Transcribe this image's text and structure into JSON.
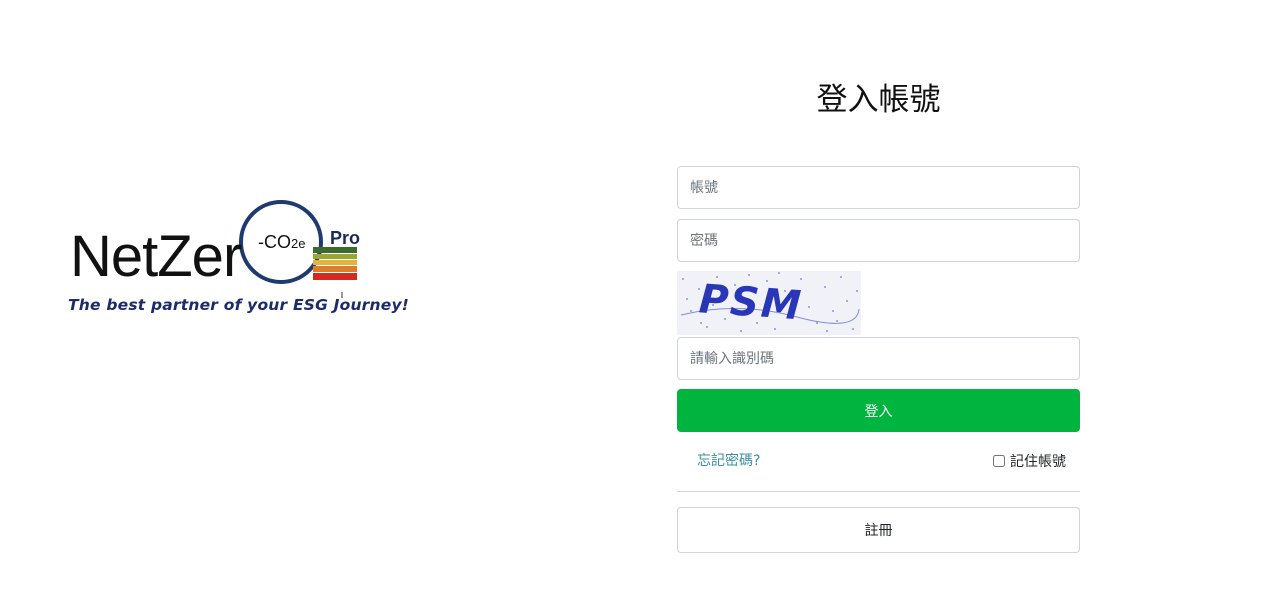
{
  "logo": {
    "wordmark": "NetZer",
    "co2_prefix": "-CO",
    "co2_sub": "2e",
    "badge": "Pro",
    "tagline": "The best partner of your ESG Journey!",
    "colors": {
      "ring": "#1e3a6e",
      "bars": [
        "#3c6a2a",
        "#9aa636",
        "#e0b53a",
        "#e07b2b",
        "#d22a1e"
      ]
    }
  },
  "login": {
    "title": "登入帳號",
    "account_placeholder": "帳號",
    "password_placeholder": "密碼",
    "captcha_text": "PSM",
    "captcha_placeholder": "請輸入識別碼",
    "login_label": "登入",
    "forgot_label": "忘記密碼?",
    "remember_label": "記住帳號",
    "remember_checked": false,
    "register_label": "註冊"
  },
  "colors": {
    "primary": "#00b53f",
    "link": "#3a8fa0",
    "captcha_text": "#2a36b8"
  }
}
